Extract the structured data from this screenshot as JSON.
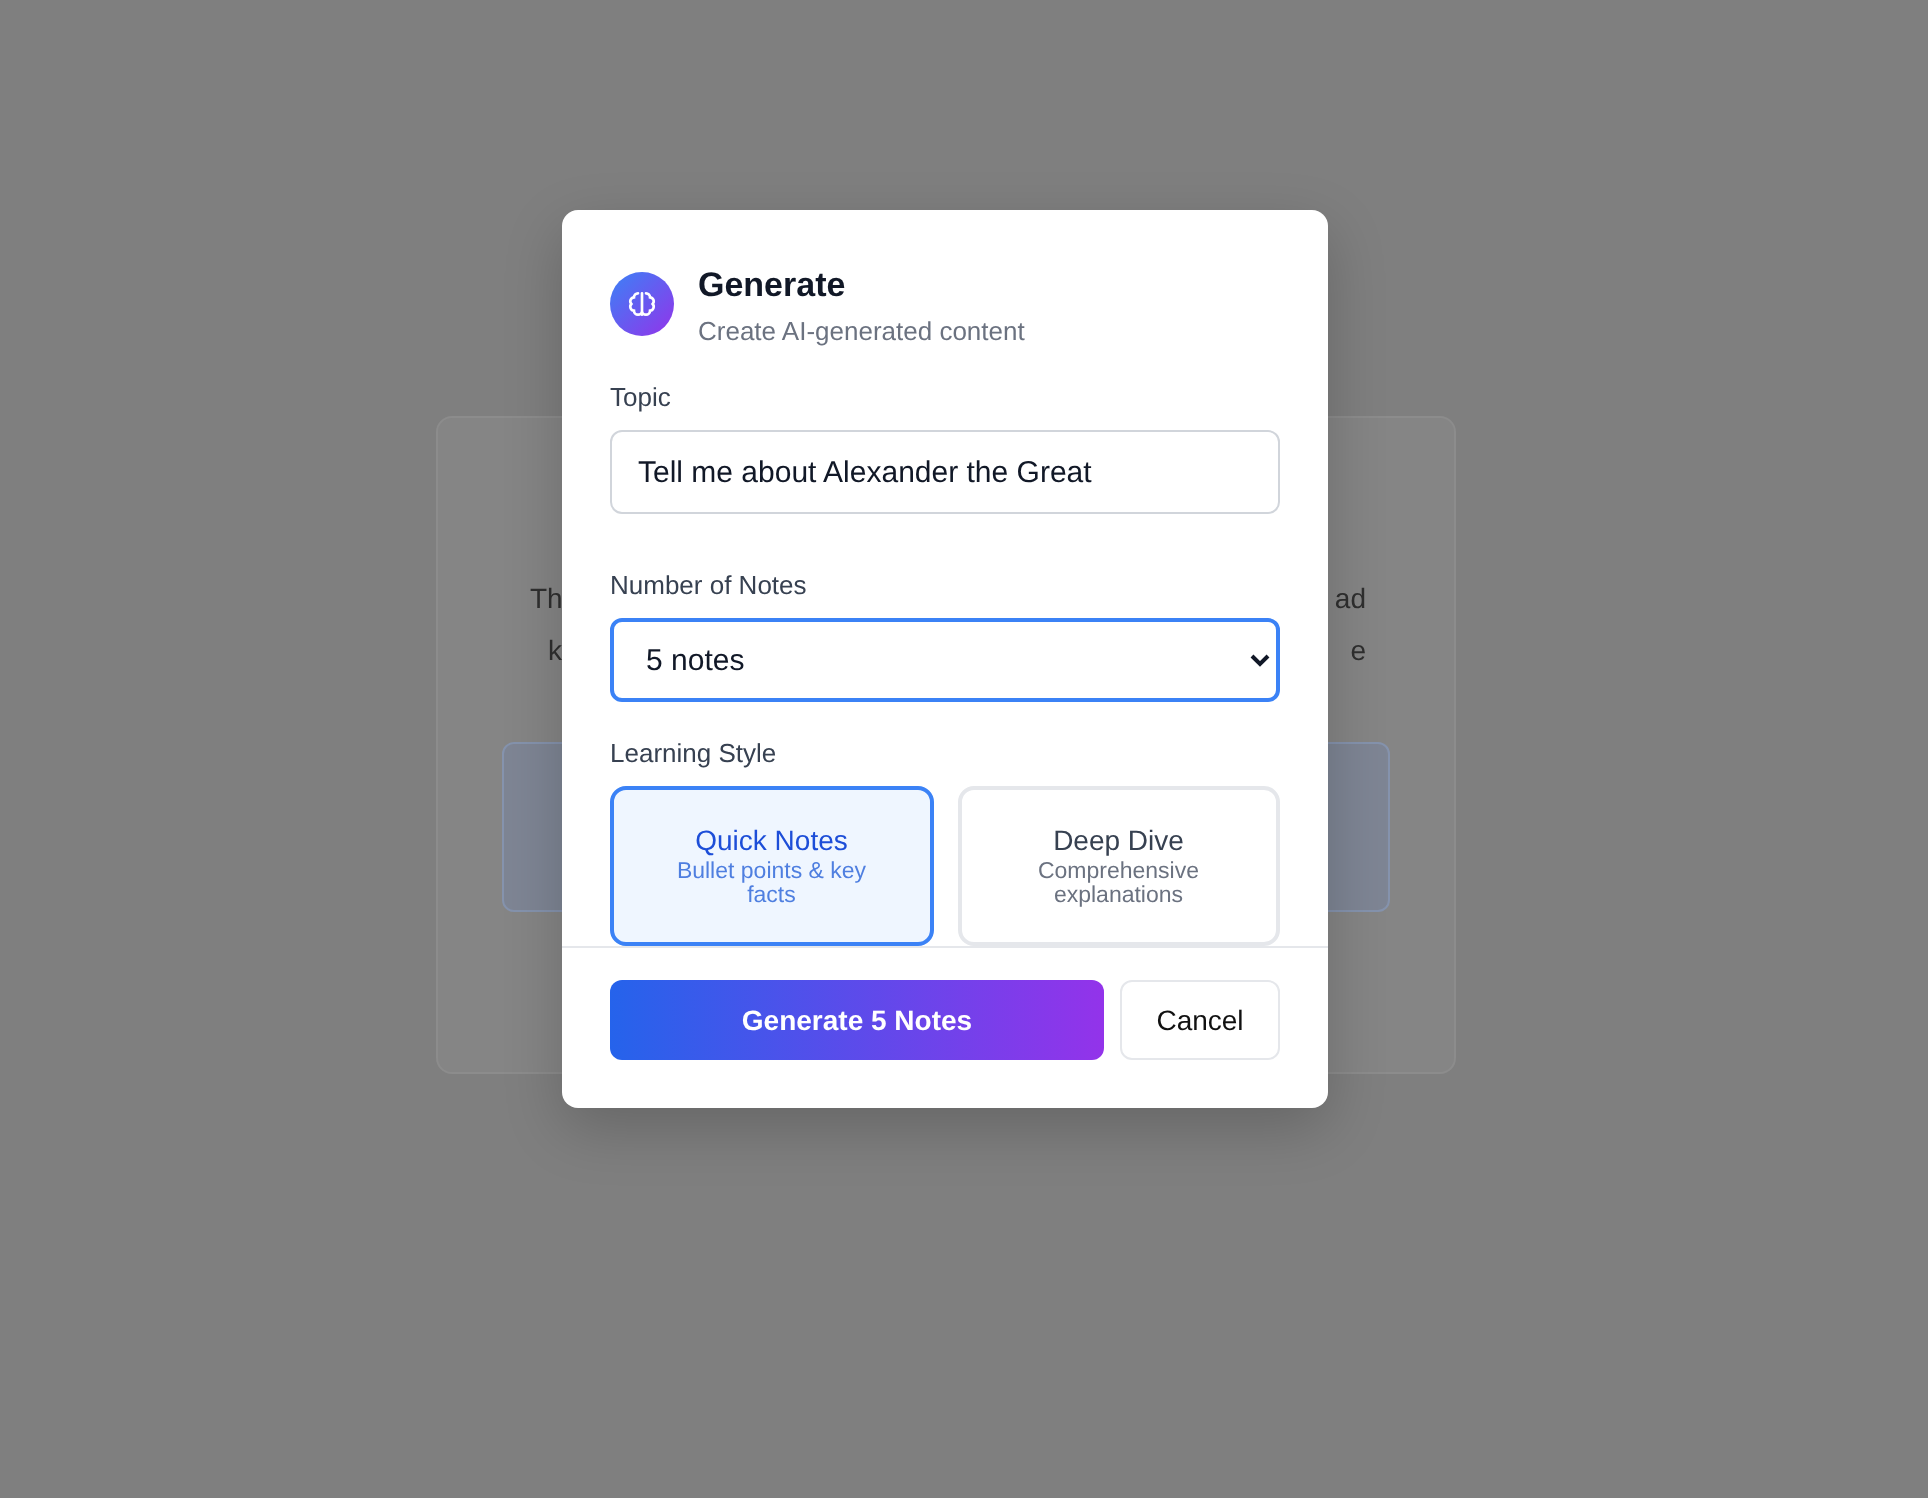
{
  "background_card": {
    "text_lines": [
      {
        "left": "Th",
        "right": "ad"
      },
      {
        "left": "k",
        "right": "e"
      }
    ]
  },
  "dialog": {
    "title": "Generate",
    "subtitle": "Create AI-generated content",
    "topic": {
      "label": "Topic",
      "value": "Tell me about Alexander the Great"
    },
    "count": {
      "label": "Number of Notes",
      "value": "5 notes",
      "focused": true
    },
    "style": {
      "label": "Learning Style",
      "options": [
        {
          "title": "Quick Notes",
          "description": "Bullet points & key facts",
          "selected": true
        },
        {
          "title": "Deep Dive",
          "description": "Comprehensive explanations",
          "selected": false
        }
      ]
    },
    "buttons": {
      "primary": "Generate 5 Notes",
      "secondary": "Cancel"
    }
  }
}
